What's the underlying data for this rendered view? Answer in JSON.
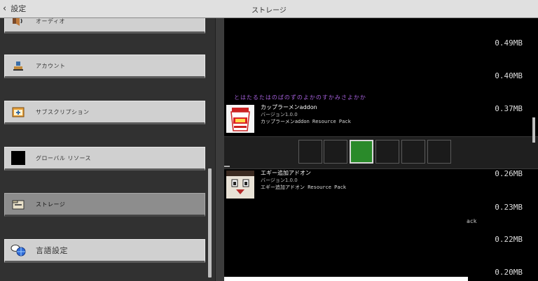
{
  "header": {
    "back_label": "設定",
    "title": "ストレージ"
  },
  "sidebar": {
    "items": [
      {
        "label": "オーディオ",
        "icon": "speaker-icon"
      },
      {
        "label": "アカウント",
        "icon": "account-icon"
      },
      {
        "label": "サブスクリプション",
        "icon": "subscription-icon"
      },
      {
        "label": "グローバル リソース",
        "icon": "global-resources-icon"
      },
      {
        "label": "ストレージ",
        "icon": "storage-folder-icon",
        "selected": true
      },
      {
        "label": "言語設定",
        "icon": "language-icon"
      }
    ]
  },
  "storage": {
    "sizes_top": [
      "0.49MB",
      "0.40MB"
    ],
    "cutoff_text": "とはたるたはのぱのずのよかのすかみさよかか",
    "packs": [
      {
        "title": "カップラーメンaddon",
        "version": "バージョン1.0.0",
        "description": "カップラーメンaddon Resource Pack",
        "size": "0.37MB"
      },
      {
        "title": "エギー追加アドオン",
        "version": "バージョン1.0.0",
        "description": "エギー追加アドオン Resource Pack",
        "size": "0.26MB"
      }
    ],
    "sizes_bottom": [
      "0.23MB",
      "0.22MB",
      "0.20MB"
    ],
    "partial_text": "ack"
  },
  "hotbar": {
    "slots": 6,
    "active_index": 2,
    "active_color": "#2a8a2a"
  }
}
